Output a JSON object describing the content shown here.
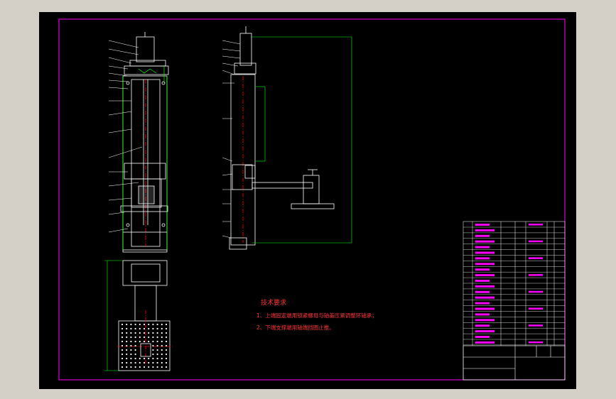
{
  "drawing": {
    "notes_title": "技术要求",
    "notes": [
      "1、上端固定端用锁紧螺母与轴盖压紧调整环轴承；",
      "2、下端支撑端用轴端挡圈止推。"
    ]
  },
  "colors": {
    "viewport_bg": "#d4d0c8",
    "sheet_bg": "#000000",
    "border": "#ff00ff",
    "outline": "#ffffff",
    "dimension": "#00ff00",
    "centerline": "#ff0000",
    "note_text": "#ff3333",
    "leader": "#00ffff"
  },
  "icons": {
    "part_leader": "leader-line",
    "hatch": "hatching"
  }
}
